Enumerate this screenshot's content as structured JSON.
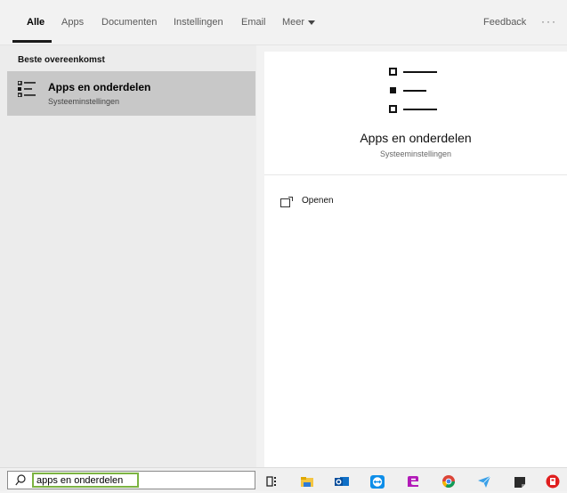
{
  "tabs": [
    {
      "label": "Alle",
      "active": true
    },
    {
      "label": "Apps"
    },
    {
      "label": "Documenten"
    },
    {
      "label": "Instellingen"
    },
    {
      "label": "Email"
    },
    {
      "label": "Meer"
    }
  ],
  "feedback_label": "Feedback",
  "more_label": "···",
  "left": {
    "section_title": "Beste overeenkomst",
    "best_match": {
      "title": "Apps en onderdelen",
      "subtitle": "Systeeminstellingen",
      "icon": "list-settings-icon"
    }
  },
  "preview": {
    "title": "Apps en onderdelen",
    "subtitle": "Systeeminstellingen",
    "icon": "list-settings-icon",
    "actions": [
      {
        "label": "Openen",
        "icon": "open-window-icon"
      }
    ]
  },
  "taskbar": {
    "search_value": "apps en onderdelen",
    "icons": [
      "task-view-icon",
      "file-explorer-icon",
      "outlook-icon",
      "teamviewer-icon",
      "edge-icon",
      "chrome-icon",
      "paper-plane-icon",
      "sticky-notes-icon",
      "red-app-icon"
    ]
  },
  "colors": {
    "accent_green": "#7cb342",
    "selected_bg": "#c8c8c8"
  }
}
